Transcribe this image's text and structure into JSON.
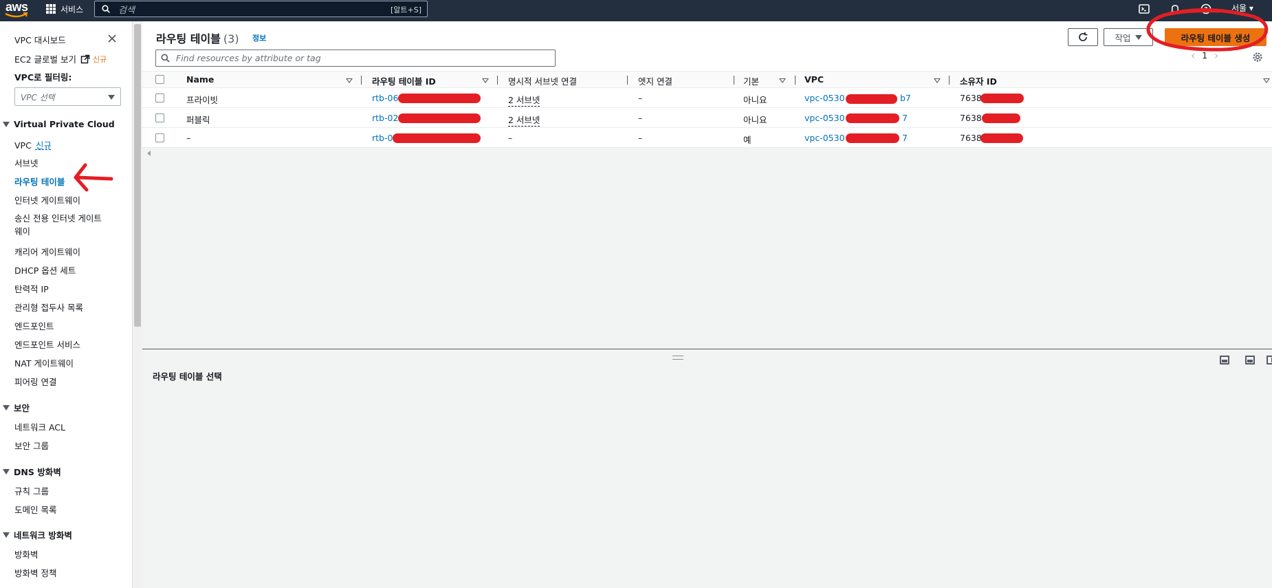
{
  "topnav": {
    "logo_text": "aws",
    "services_label": "서비스",
    "search_placeholder": "검색",
    "search_shortcut": "[알트+S]",
    "region_label": "서울 ▾"
  },
  "sidebar": {
    "dashboard": "VPC 대시보드",
    "ec2_global": "EC2 글로벌 보기",
    "ec2_new": "신규",
    "filter_label": "VPC로 필터링:",
    "vpc_select_placeholder": "VPC 선택",
    "section_vpc": "Virtual Private Cloud",
    "vpc": "VPC",
    "vpc_new": "신규",
    "subnets": "서브넷",
    "route_tables": "라우팅 테이블",
    "igw": "인터넷 게이트웨이",
    "egress_igw_1": "송신 전용 인터넷 게이트",
    "egress_igw_2": "웨이",
    "carrier_gw": "캐리어 게이트웨이",
    "dhcp": "DHCP 옵션 세트",
    "eip": "탄력적 IP",
    "prefix_lists": "관리형 접두사 목록",
    "endpoints": "엔드포인트",
    "endpoint_services": "엔드포인트 서비스",
    "nat_gw": "NAT 게이트웨이",
    "peering": "피어링 연결",
    "section_security": "보안",
    "nacl": "네트워크 ACL",
    "security_groups": "보안 그룹",
    "section_dns": "DNS 방화벽",
    "rule_groups": "규칙 그룹",
    "domain_lists": "도메인 목록",
    "section_nfw": "네트워크 방화벽",
    "firewalls": "방화벽",
    "firewall_policies": "방화벽 정책"
  },
  "header": {
    "title": "라우팅 테이블",
    "count": "(3)",
    "info": "정보",
    "actions": "작업",
    "create": "라우팅 테이블 생성",
    "filter_placeholder": "Find resources by attribute or tag",
    "page": "1"
  },
  "table": {
    "columns": [
      "Name",
      "라우팅 테이블 ID",
      "명시적 서브넷 연결",
      "엣지 연결",
      "기본",
      "VPC",
      "소유자 ID"
    ],
    "rows": [
      {
        "name": "프라이빗",
        "rtb": "rtb-0625",
        "subnet": "2 서브넷",
        "edge": "–",
        "main": "아니요",
        "vpc": "vpc-0530",
        "vpc_tail": "b7",
        "owner": "7638"
      },
      {
        "name": "퍼블릭",
        "rtb": "rtb-025",
        "subnet": "2 서브넷",
        "edge": "–",
        "main": "아니요",
        "vpc": "vpc-0530",
        "vpc_tail": "7",
        "owner": "7638"
      },
      {
        "name": "–",
        "rtb": "rtb-07",
        "subnet": "–",
        "edge": "–",
        "main": "예",
        "vpc": "vpc-0530",
        "vpc_tail": "7",
        "owner": "7638"
      }
    ]
  },
  "bottom": {
    "title": "라우팅 테이블 선택"
  },
  "colors": {
    "accent": "#ec7211",
    "link": "#0073bb",
    "annotation_red": "#e31e24"
  }
}
